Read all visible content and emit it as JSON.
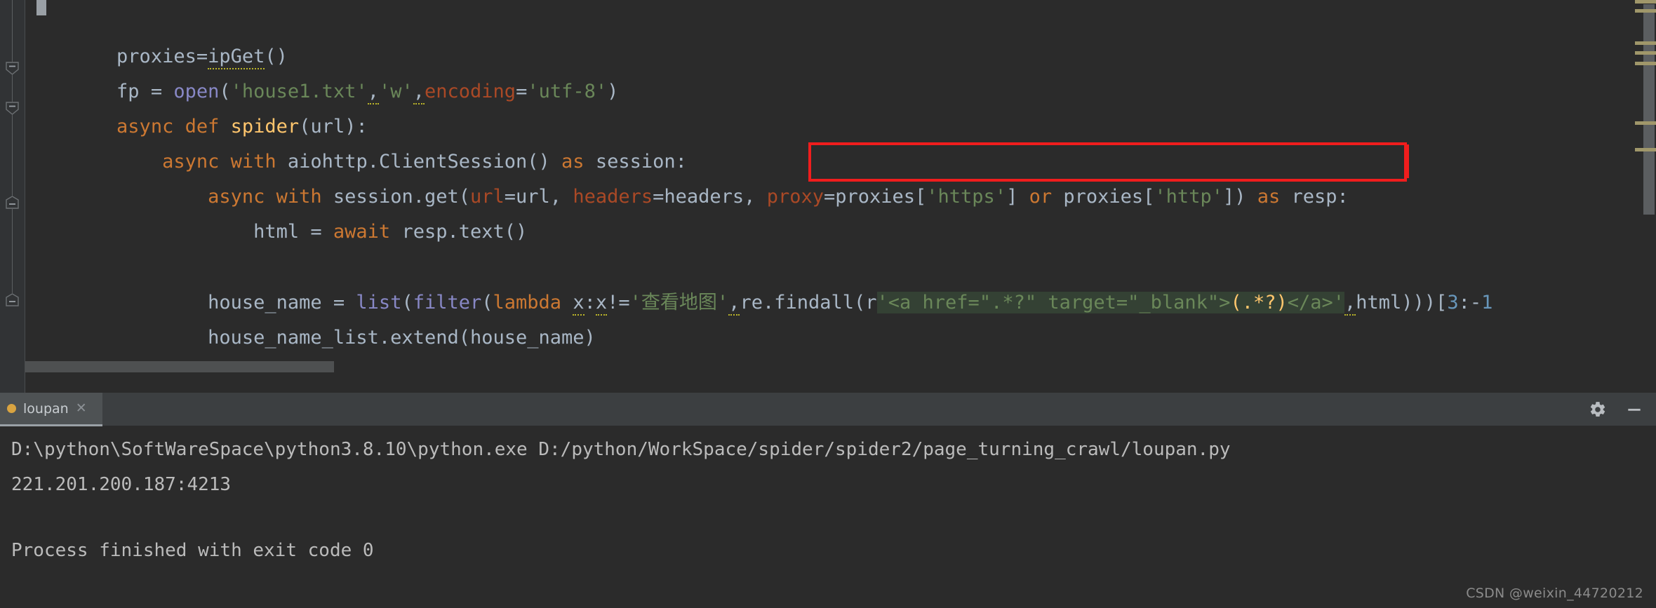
{
  "editor": {
    "lines": [
      {
        "id": "line-proxies",
        "text": "proxies=ipGet()",
        "segments": [
          {
            "t": "proxies=",
            "c": "plain"
          },
          {
            "t": "ipGet",
            "c": "plain"
          },
          {
            "t": "()",
            "c": "plain"
          }
        ]
      },
      {
        "id": "line-open-file",
        "text": "fp = open('house1.txt','w',encoding='utf-8')"
      },
      {
        "id": "line-async-def-spider",
        "text": "async def spider(url):"
      },
      {
        "id": "line-client-session",
        "text": "    async with aiohttp.ClientSession() as session:"
      },
      {
        "id": "line-session-get",
        "text": "        async with session.get(url=url, headers=headers, proxy=proxies['https'] or proxies['http']) as resp:"
      },
      {
        "id": "line-await-text",
        "text": "            html = await resp.text()"
      },
      {
        "id": "line-blank",
        "text": ""
      },
      {
        "id": "line-house-name",
        "text": "        house_name = list(filter(lambda x:x!='查看地图',re.findall(r'<a href=\".*?\" target=\"_blank\">(.*?)</a>',html)))[3:-1"
      },
      {
        "id": "line-extend",
        "text": "        house_name_list.extend(house_name)"
      }
    ],
    "tokens": {
      "kw_async": "async",
      "kw_def": "def",
      "kw_with": "with",
      "kw_as": "as",
      "kw_await": "await",
      "kw_lambda": "lambda",
      "kw_or": "or",
      "fn_spider": "spider",
      "builtin_open": "open",
      "builtin_list": "list",
      "builtin_filter": "filter",
      "str_house1": "'house1.txt'",
      "str_w": "'w'",
      "str_utf8": "'utf-8'",
      "kwarg_encoding": "encoding",
      "kwarg_url": "url",
      "kwarg_headers": "headers",
      "kwarg_proxy": "proxy",
      "str_https": "'https'",
      "str_http": "'http'",
      "str_chinese": "'查看地图'",
      "regex_literal": "'<a href=\".*?\" target=\"_blank\">(.*?)</a>'",
      "regex_group": "(.*?)"
    },
    "annotation": {
      "name": "red-highlight-box",
      "color": "#f01d1d",
      "contains": "proxy=proxies['https'] or proxies['http'])"
    },
    "highlight": {
      "name": "regex-green-highlight",
      "color": "#344134"
    }
  },
  "tool_window": {
    "tab": {
      "label": "loupan",
      "close_label": "✕",
      "run_dot_color": "#d9a441"
    },
    "actions": {
      "settings_label": "gear-icon",
      "hide_label": "minimize-icon"
    }
  },
  "console": {
    "lines": [
      "D:\\python\\SoftWareSpace\\python3.8.10\\python.exe D:/python/WorkSpace/spider/spider2/page_turning_crawl/loupan.py",
      "221.201.200.187:4213",
      "",
      "Process finished with exit code 0"
    ]
  },
  "watermark": {
    "text": "CSDN @weixin_44720212"
  },
  "colors": {
    "editor_bg": "#2b2b2b",
    "gutter_bg": "#313335",
    "panel_bg": "#3c3f41",
    "default_text": "#a9b7c6",
    "keyword": "#cc7832",
    "function": "#ffc66d",
    "builtin": "#8888c6",
    "string": "#6a8759",
    "kwarg": "#aa4926",
    "number": "#6897bb",
    "console_text": "#bbbbbb",
    "annotation_red": "#f01d1d",
    "highlight_green": "#344134",
    "marker_olive": "#a0976a"
  }
}
